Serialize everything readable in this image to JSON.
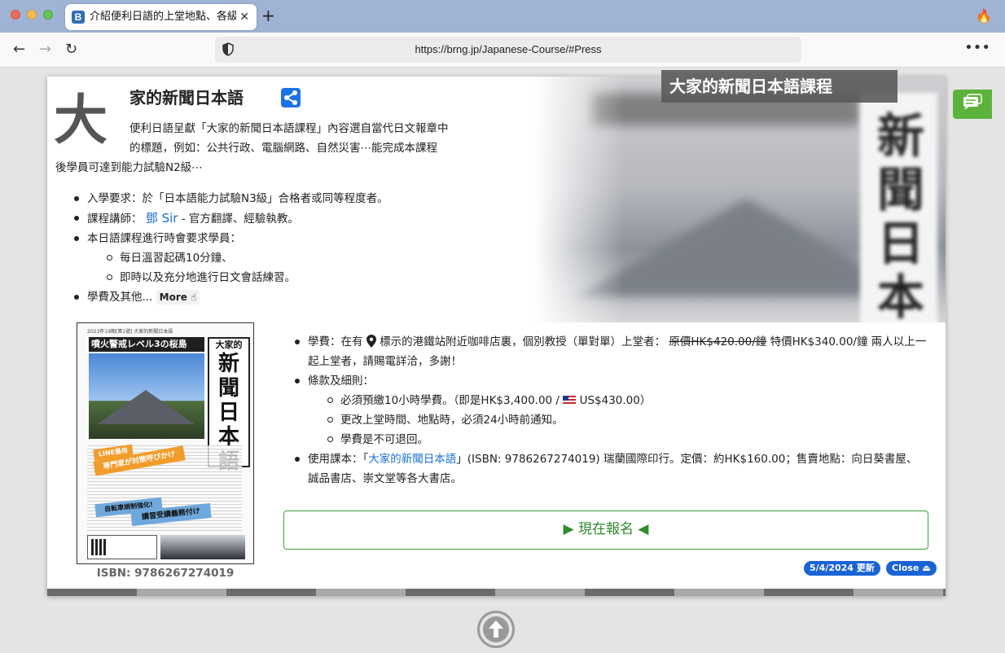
{
  "browser": {
    "tab_title": "介紹便利日語的上堂地點、各級日",
    "tab_favicon": "B",
    "tab_close": "✕",
    "new_tab": "+",
    "url": "https://brng.jp/Japanese-Course/#Press",
    "back": "←",
    "forward": "→",
    "reload": "↻",
    "menu": "•••",
    "flame_icon": "🔥"
  },
  "hero": {
    "title": "大家的新聞日本語課程",
    "kanji": "新聞日本"
  },
  "course": {
    "drop_cap": "大",
    "title": "家的新聞日本語",
    "intro_line1": "便利日語呈獻「大家的新聞日本語課程」內容選自當代日文報章中",
    "intro_line2": "的標題，例如：公共行政、電腦網路、自然災害⋯能完成本課程",
    "intro_line3": "後學員可達到能力試驗N2級⋯"
  },
  "requirements": {
    "entry": "入學要求：於「日本語能力試驗N3級」合格者或同等程度者。",
    "teacher_prefix": "課程講師：",
    "teacher_name": "鄧 Sir",
    "teacher_suffix": " - 官方翻譯、經驗執教。",
    "expect": "本日語課程進行時會要求學員：",
    "expect_items": [
      "每日溫習起碼10分鐘、",
      "即時以及充分地進行日文會話練習。"
    ],
    "fees_other": "學費及其他...",
    "more_label": "More",
    "more_icon": "☝"
  },
  "book": {
    "small_text": "2023年19期[第1號] 大家的新聞日本語",
    "headline": "噴火警戒レベル3の桜島",
    "vertical_small": "大家的",
    "vertical_title": "新聞日本語",
    "ribbon1": "LINE番用",
    "ribbon2": "専門家が対策呼びかけ",
    "ribbon3": "自転車規制強化!",
    "ribbon4": "講習受講義務付け",
    "isbn_caption": "ISBN: 9786267274019"
  },
  "details": {
    "fee_prefix": "學費：在有",
    "fee_middle": "標示的港鐵站附近咖啡店裏，個別教授（單對單）上堂者：",
    "fee_original": "原價HK$420.00/鐘",
    "fee_special": " 特價HK$340.00/鐘 兩人以上一起上堂者，請賜電詳洽，多謝！",
    "terms": "條款及細則：",
    "terms_items": [
      "必須預繳10小時學費。（即是HK$3,400.00 /",
      "US$430.00）",
      "更改上堂時間、地點時，必須24小時前通知。",
      "學費是不可退回。"
    ],
    "textbook_prefix": "使用課本：「",
    "textbook_link": "大家的新聞日本語",
    "textbook_suffix": "」(ISBN: 9786267274019) 瑞蘭國際印行。定價：約HK$160.00；售賣地點：向日葵書屋、誠品書店、崇文堂等各大書店。"
  },
  "actions": {
    "enroll": "▶ 現在報名 ◀",
    "updated": "5/4/2024 更新",
    "close": "Close ⏏"
  },
  "colors": {
    "accent": "#1a63d6",
    "enroll_green": "#2e8b2e",
    "chat_green": "#5cb33c"
  }
}
